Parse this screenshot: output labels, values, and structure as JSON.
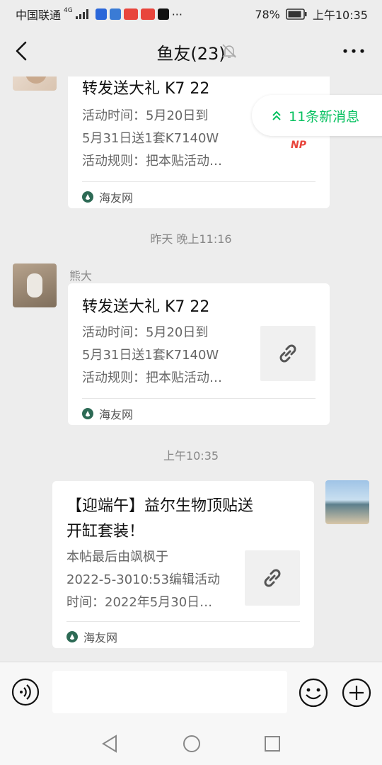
{
  "status_bar": {
    "carrier": "中国联通",
    "network": "4G",
    "battery": "78%",
    "time": "上午10:35"
  },
  "header": {
    "title": "鱼友(23)"
  },
  "new_messages_label": "11条新消息",
  "messages": [
    {
      "title": "转发送大礼 K7 22",
      "desc": "活动时间：5月20日到\n5月31日送1套K7140W\n活动规则：把本贴活动…",
      "source": "海友网",
      "thumb_text": "NP"
    },
    {
      "timestamp": "昨天 晚上11:16",
      "sender": "熊大",
      "title": "转发送大礼 K7 22",
      "desc": "活动时间：5月20日到\n5月31日送1套K7140W\n活动规则：把本贴活动…",
      "source": "海友网"
    },
    {
      "timestamp": "上午10:35",
      "title": "【迎端午】益尔生物顶贴送\n开缸套装！",
      "desc": "本帖最后由飒枫于\n2022-5-3010:53编辑活动\n时间：2022年5月30日…",
      "source": "海友网"
    }
  ],
  "input": {
    "placeholder": ""
  },
  "colors": {
    "accent": "#07c160",
    "background": "#ededed"
  }
}
